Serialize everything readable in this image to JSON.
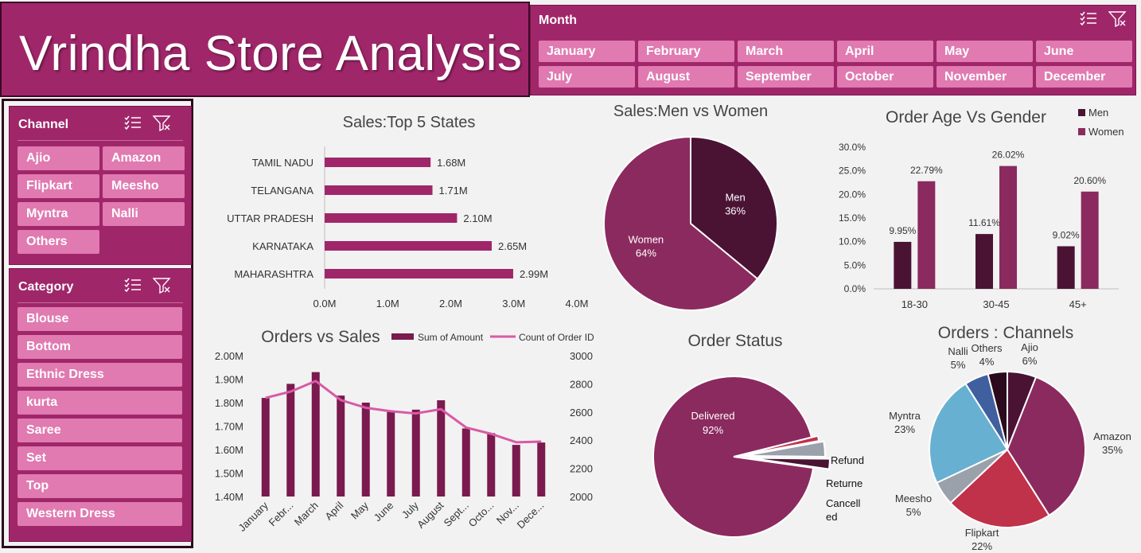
{
  "header": {
    "title": "Vrindha Store Analysis"
  },
  "month_slicer": {
    "heading": "Month",
    "items": [
      "January",
      "February",
      "March",
      "April",
      "May",
      "June",
      "July",
      "August",
      "September",
      "October",
      "November",
      "December"
    ]
  },
  "channel_slicer": {
    "heading": "Channel",
    "items": [
      "Ajio",
      "Amazon",
      "Flipkart",
      "Meesho",
      "Myntra",
      "Nalli",
      "Others"
    ]
  },
  "category_slicer": {
    "heading": "Category",
    "items": [
      "Blouse",
      "Bottom",
      "Ethnic Dress",
      "kurta",
      "Saree",
      "Set",
      "Top",
      "Western Dress"
    ]
  },
  "icons": {
    "multiselect": "multi-select-icon",
    "clear_filter": "clear-filter-icon"
  },
  "colors": {
    "brand": "#a0266a",
    "button": "#e07ab1",
    "dark": "#4a1334",
    "mid": "#8b2a5e",
    "light_line": "#d95aa6"
  },
  "chart_data": [
    {
      "id": "top5states",
      "type": "bar",
      "orientation": "horizontal",
      "title": "Sales:Top 5 States",
      "categories": [
        "TAMIL NADU",
        "TELANGANA",
        "UTTAR PRADESH",
        "KARNATAKA",
        "MAHARASHTRA"
      ],
      "values": [
        1.68,
        1.71,
        2.1,
        2.65,
        2.99
      ],
      "value_labels": [
        "1.68M",
        "1.71M",
        "2.10M",
        "2.65M",
        "2.99M"
      ],
      "xticks": [
        "0.0M",
        "1.0M",
        "2.0M",
        "3.0M",
        "4.0M"
      ],
      "xlim": [
        0,
        4
      ]
    },
    {
      "id": "menwomen",
      "type": "pie",
      "title": "Sales:Men vs Women",
      "slices": [
        {
          "label": "Men",
          "value": 36,
          "pct": "36%",
          "color": "#4a1334"
        },
        {
          "label": "Women",
          "value": 64,
          "pct": "64%",
          "color": "#8b2a5e"
        }
      ]
    },
    {
      "id": "agegender",
      "type": "bar",
      "title": "Order Age Vs Gender",
      "categories": [
        "18-30",
        "30-45",
        "45+"
      ],
      "series": [
        {
          "name": "Men",
          "values": [
            9.95,
            11.61,
            9.02
          ],
          "labels": [
            "9.95%",
            "11.61%",
            "9.02%"
          ],
          "color": "#4a1334"
        },
        {
          "name": "Women",
          "values": [
            22.79,
            26.02,
            20.6
          ],
          "labels": [
            "22.79%",
            "26.02%",
            "20.60%"
          ],
          "color": "#8b2a5e"
        }
      ],
      "yticks": [
        "0.0%",
        "5.0%",
        "10.0%",
        "15.0%",
        "20.0%",
        "25.0%",
        "30.0%"
      ],
      "ylim": [
        0,
        30
      ],
      "legend": "top-right"
    },
    {
      "id": "orderssales",
      "type": "bar",
      "title": "Orders vs Sales",
      "categories": [
        "January",
        "Febr...",
        "March",
        "April",
        "May",
        "June",
        "July",
        "August",
        "Sept...",
        "Octo...",
        "Nov...",
        "Dece..."
      ],
      "series": [
        {
          "name": "Sum of Amount",
          "type": "bar",
          "axis": "left",
          "values": [
            1.82,
            1.88,
            1.93,
            1.83,
            1.8,
            1.76,
            1.77,
            1.81,
            1.69,
            1.67,
            1.62,
            1.63
          ],
          "color": "#7a1a4e"
        },
        {
          "name": "Count of Order ID",
          "type": "line",
          "axis": "right",
          "values": [
            2700,
            2745,
            2820,
            2685,
            2630,
            2605,
            2590,
            2620,
            2490,
            2445,
            2385,
            2390
          ],
          "color": "#d95aa6"
        }
      ],
      "yticks_left": [
        "1.40M",
        "1.50M",
        "1.60M",
        "1.70M",
        "1.80M",
        "1.90M",
        "2.00M"
      ],
      "ylim_left": [
        1.4,
        2.0
      ],
      "yticks_right": [
        "2000",
        "2200",
        "2400",
        "2600",
        "2800",
        "3000"
      ],
      "ylim_right": [
        2000,
        3000
      ],
      "legend": "top"
    },
    {
      "id": "orderstatus",
      "type": "pie",
      "title": "Order Status",
      "slices": [
        {
          "label": "Delivered",
          "value": 92,
          "pct": "92%",
          "color": "#8b2a5e"
        },
        {
          "label": "Refund",
          "value": 1,
          "pct": "",
          "color": "#c0314a"
        },
        {
          "label": "Returne",
          "value": 3,
          "pct": "",
          "color": "#9aa1ab"
        },
        {
          "label": "Cancell\ned",
          "value": 2,
          "pct": "",
          "color": "#4a1334"
        }
      ]
    },
    {
      "id": "channels",
      "type": "pie",
      "title": "Orders : Channels",
      "slices": [
        {
          "label": "Ajio",
          "value": 6,
          "pct": "6%",
          "color": "#4a1334"
        },
        {
          "label": "Amazon",
          "value": 35,
          "pct": "35%",
          "color": "#8b2a5e"
        },
        {
          "label": "Flipkart",
          "value": 22,
          "pct": "22%",
          "color": "#c0314a"
        },
        {
          "label": "Meesho",
          "value": 5,
          "pct": "5%",
          "color": "#9aa1ab"
        },
        {
          "label": "Myntra",
          "value": 23,
          "pct": "23%",
          "color": "#67b0d1"
        },
        {
          "label": "Nalli",
          "value": 5,
          "pct": "5%",
          "color": "#3f5f9e"
        },
        {
          "label": "Others",
          "value": 4,
          "pct": "4%",
          "color": "#2a0a1c"
        }
      ]
    }
  ]
}
